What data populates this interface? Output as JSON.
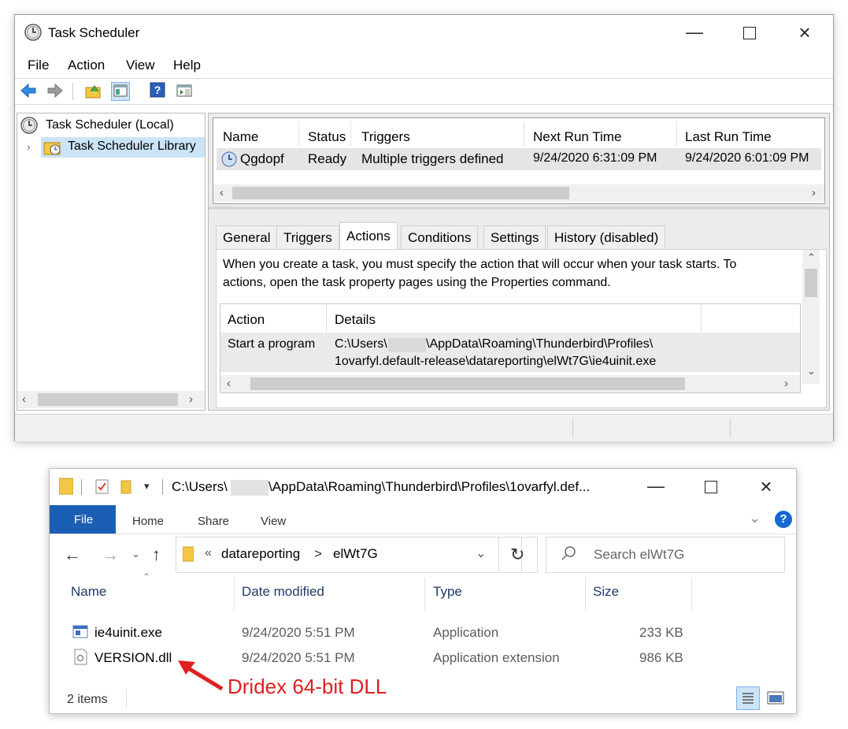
{
  "task_scheduler": {
    "title": "Task Scheduler",
    "menu": [
      "File",
      "Action",
      "View",
      "Help"
    ],
    "tree": {
      "root": "Task Scheduler (Local)",
      "child": "Task Scheduler Library"
    },
    "task_table": {
      "columns": [
        "Name",
        "Status",
        "Triggers",
        "Next Run Time",
        "Last Run Time"
      ],
      "rows": [
        {
          "name": "Qgdopf",
          "status": "Ready",
          "triggers": "Multiple triggers defined",
          "next_run": "9/24/2020 6:31:09 PM",
          "last_run": "9/24/2020 6:01:09 PM"
        }
      ]
    },
    "tabs": [
      "General",
      "Triggers",
      "Actions",
      "Conditions",
      "Settings",
      "History (disabled)"
    ],
    "active_tab": "Actions",
    "actions_desc_line1": "When you create a task, you must specify the action that will occur when your task starts.  To",
    "actions_desc_line2": "actions, open the task property pages using the Properties command.",
    "actions_table": {
      "columns": [
        "Action",
        "Details"
      ],
      "rows": [
        {
          "action": "Start a program",
          "details_line1_a": "C:\\Users\\",
          "details_line1_b": "\\AppData\\Roaming\\Thunderbird\\Profiles\\",
          "details_line2": "1ovarfyl.default-release\\datareporting\\elWt7G\\ie4uinit.exe"
        }
      ]
    }
  },
  "explorer": {
    "title_a": "C:\\Users\\",
    "title_b": "\\AppData\\Roaming\\Thunderbird\\Profiles\\1ovarfyl.def...",
    "ribbon_tabs": [
      "File",
      "Home",
      "Share",
      "View"
    ],
    "breadcrumb": {
      "sep": "«",
      "part1": "datareporting",
      "arrow": ">",
      "part2": "elWt7G"
    },
    "search_placeholder": "Search elWt7G",
    "columns": [
      "Name",
      "Date modified",
      "Type",
      "Size"
    ],
    "files": [
      {
        "name": "ie4uinit.exe",
        "date": "9/24/2020 5:51 PM",
        "type": "Application",
        "size": "233 KB"
      },
      {
        "name": "VERSION.dll",
        "date": "9/24/2020 5:51 PM",
        "type": "Application extension",
        "size": "986 KB"
      }
    ],
    "item_count": "2 items"
  },
  "annotation": {
    "text": "Dridex 64-bit DLL",
    "color": "#e02020"
  },
  "colors": {
    "ribbon_file_blue": "#1a5fb4",
    "help_blue": "#1769d2",
    "header_blue": "#1f3a66"
  }
}
